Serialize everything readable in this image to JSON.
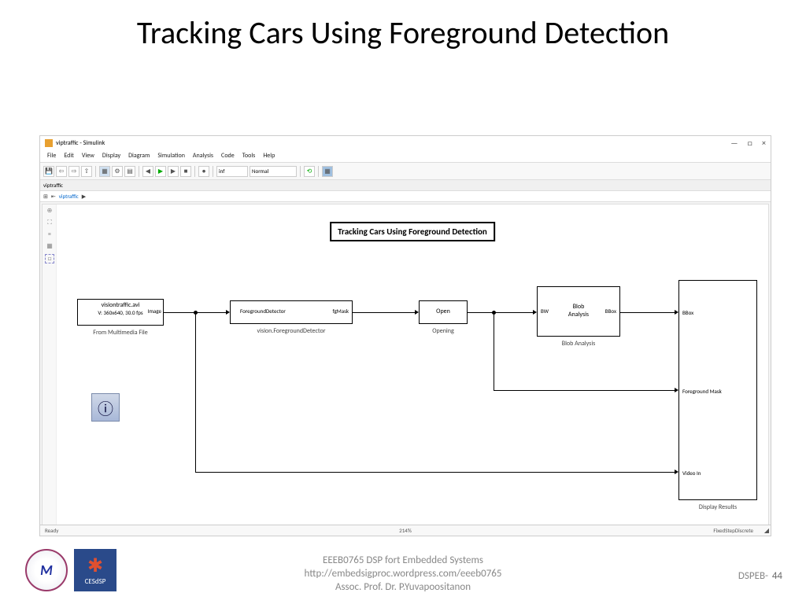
{
  "slide": {
    "title": "Tracking Cars Using Foreground Detection"
  },
  "window": {
    "title": "viptraffic - Simulink",
    "controls": {
      "min": "—",
      "max": "□",
      "close": "×"
    }
  },
  "menu": {
    "items": [
      "File",
      "Edit",
      "View",
      "Display",
      "Diagram",
      "Simulation",
      "Analysis",
      "Code",
      "Tools",
      "Help"
    ]
  },
  "toolbar": {
    "stop_time": "inf",
    "mode": "Normal"
  },
  "tabs": {
    "active": "viptraffic"
  },
  "breadcrumb": {
    "model": "viptraffic",
    "arrow": "▶"
  },
  "diagram": {
    "title": "Tracking Cars Using Foreground Detection",
    "blocks": {
      "source": {
        "line1": "visiontraffic.avi",
        "line2": "V: 360x640, 30.0 fps",
        "out_port": "Image",
        "label": "From Multimedia File"
      },
      "fgdet": {
        "name": "ForegroundDetector",
        "out_port": "fgMask",
        "label": "vision.ForegroundDetector"
      },
      "open": {
        "name": "Open",
        "label": "Opening"
      },
      "blob": {
        "name": "Blob\nAnalysis",
        "in_port": "BW",
        "out_port": "BBox",
        "label": "Blob Analysis"
      },
      "display": {
        "in1": "BBox",
        "in2": "Foreground Mask",
        "in3": "Video In",
        "label": "Display Results"
      }
    },
    "info_icon": "ⓘ"
  },
  "statusbar": {
    "left": "Ready",
    "mid": "214%",
    "right": "FixedStepDiscrete"
  },
  "footer": {
    "line1": "EEEB0765 DSP fort Embedded Systems",
    "line2": "http://embedsigproc.wordpress.com/eeeb0765",
    "line3": "Assoc. Prof. Dr. P.Yuvapoositanon",
    "page_code": "DSPEB-",
    "page_num": "44"
  },
  "logos": {
    "logo1_text": "M",
    "logo2_text": "CESdSP",
    "logo2_spark": "✱"
  }
}
